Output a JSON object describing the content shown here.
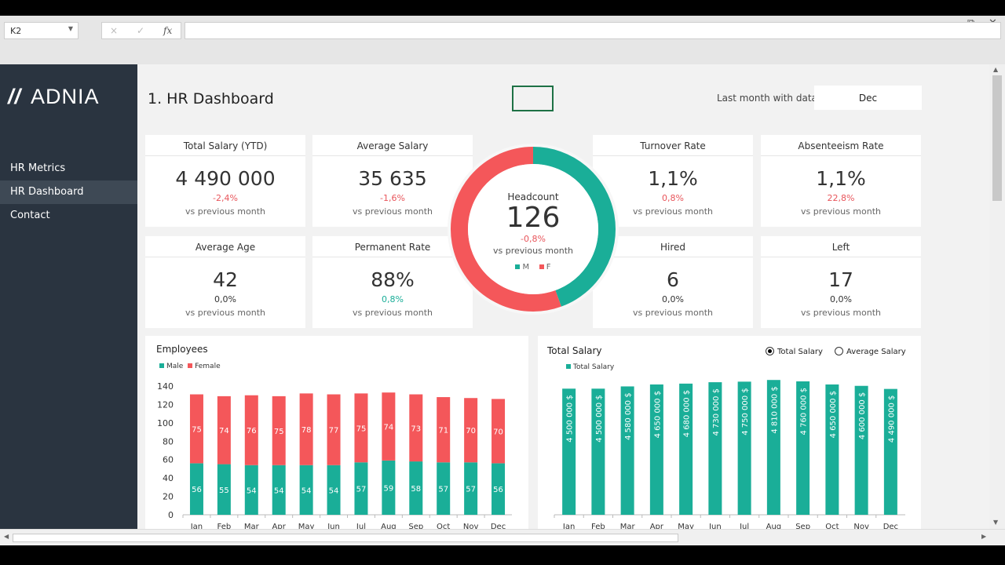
{
  "excel": {
    "name_box": "K2",
    "formula": "",
    "cancel_icon": "×",
    "enter_icon": "✓",
    "fx_label": "fx",
    "window_icons": [
      "…",
      "⧉",
      "✕"
    ]
  },
  "sidebar": {
    "logo": "ADNIA",
    "items": [
      {
        "label": "HR Metrics"
      },
      {
        "label": "HR Dashboard",
        "active": true
      },
      {
        "label": "Contact"
      }
    ]
  },
  "header": {
    "title": "1. HR Dashboard",
    "last_month_label": "Last month with data:",
    "last_month_value": "Dec"
  },
  "kpis": [
    {
      "title": "Total Salary (YTD)",
      "value": "4 490 000",
      "delta": "-2,4%",
      "trend": "neg",
      "sub": "vs previous month"
    },
    {
      "title": "Average Salary",
      "value": "35 635",
      "delta": "-1,6%",
      "trend": "neg",
      "sub": "vs previous month"
    },
    {
      "title": "Turnover Rate",
      "value": "1,1%",
      "delta": "0,8%",
      "trend": "neg",
      "sub": "vs previous month"
    },
    {
      "title": "Absenteeism Rate",
      "value": "1,1%",
      "delta": "22,8%",
      "trend": "neg",
      "sub": "vs previous month"
    },
    {
      "title": "Average Age",
      "value": "42",
      "delta": "0,0%",
      "trend": "neu",
      "sub": "vs previous month"
    },
    {
      "title": "Permanent Rate",
      "value": "88%",
      "delta": "0,8%",
      "trend": "pos",
      "sub": "vs previous month"
    },
    {
      "title": "Hired",
      "value": "6",
      "delta": "0,0%",
      "trend": "neu",
      "sub": "vs previous month"
    },
    {
      "title": "Left",
      "value": "17",
      "delta": "0,0%",
      "trend": "neu",
      "sub": "vs previous month"
    }
  ],
  "headcount": {
    "title": "Headcount",
    "value": "126",
    "delta": "-0,8%",
    "sub": "vs previous month",
    "male": 56,
    "female": 70,
    "legend_m": "M",
    "legend_f": "F"
  },
  "colors": {
    "male": "#1aae98",
    "female": "#f4575a",
    "sidebar": "#2a3440"
  },
  "chart_data": [
    {
      "type": "bar",
      "stacked": true,
      "title": "Employees",
      "categories": [
        "Jan",
        "Feb",
        "Mar",
        "Apr",
        "May",
        "Jun",
        "Jul",
        "Aug",
        "Sep",
        "Oct",
        "Nov",
        "Dec"
      ],
      "series": [
        {
          "name": "Male",
          "values": [
            56,
            55,
            54,
            54,
            54,
            54,
            57,
            59,
            58,
            57,
            57,
            56
          ]
        },
        {
          "name": "Female",
          "values": [
            75,
            74,
            76,
            75,
            78,
            77,
            75,
            74,
            73,
            71,
            70,
            70
          ]
        }
      ],
      "ylim": [
        0,
        140
      ],
      "yticks": [
        0,
        20,
        40,
        60,
        80,
        100,
        120,
        140
      ],
      "legend": "top-left"
    },
    {
      "type": "bar",
      "title": "Total Salary",
      "categories": [
        "Jan",
        "Feb",
        "Mar",
        "Apr",
        "May",
        "Jun",
        "Jul",
        "Aug",
        "Sep",
        "Oct",
        "Nov",
        "Dec"
      ],
      "series": [
        {
          "name": "Total Salary",
          "values": [
            4500000,
            4500000,
            4580000,
            4650000,
            4680000,
            4730000,
            4750000,
            4810000,
            4760000,
            4650000,
            4600000,
            4490000
          ]
        }
      ],
      "data_labels": [
        "4 500 000 $",
        "4 500 000 $",
        "4 580 000 $",
        "4 650 000 $",
        "4 680 000 $",
        "4 730 000 $",
        "4 750 000 $",
        "4 810 000 $",
        "4 760 000 $",
        "4 650 000 $",
        "4 600 000 $",
        "4 490 000 $"
      ],
      "legend": "top-left",
      "options": [
        {
          "label": "Total Salary",
          "selected": true
        },
        {
          "label": "Average Salary",
          "selected": false
        }
      ]
    }
  ]
}
